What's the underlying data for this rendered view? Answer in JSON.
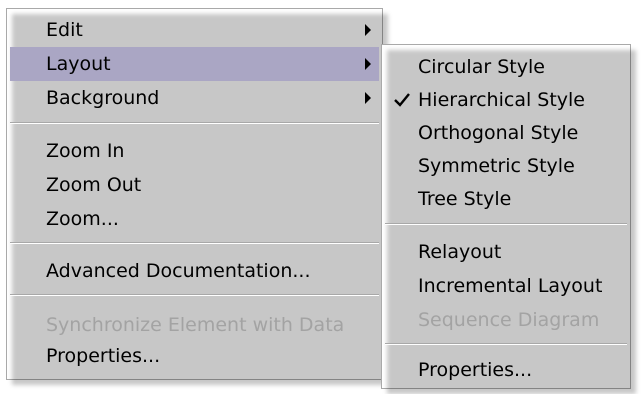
{
  "main_menu": {
    "items": [
      {
        "label": "Edit",
        "has_submenu": true,
        "state": "normal"
      },
      {
        "label": "Layout",
        "has_submenu": true,
        "state": "highlighted"
      },
      {
        "label": "Background",
        "has_submenu": true,
        "state": "normal"
      },
      {
        "label": "Zoom In",
        "state": "normal"
      },
      {
        "label": "Zoom Out",
        "state": "normal"
      },
      {
        "label": "Zoom...",
        "state": "normal"
      },
      {
        "label": "Advanced Documentation...",
        "state": "normal"
      },
      {
        "label": "Synchronize Element with Data",
        "state": "disabled"
      },
      {
        "label": "Properties...",
        "state": "normal"
      }
    ]
  },
  "layout_submenu": {
    "items": [
      {
        "label": "Circular Style",
        "checked": false,
        "state": "normal"
      },
      {
        "label": "Hierarchical Style",
        "checked": true,
        "state": "normal"
      },
      {
        "label": "Orthogonal Style",
        "checked": false,
        "state": "normal"
      },
      {
        "label": "Symmetric Style",
        "checked": false,
        "state": "normal"
      },
      {
        "label": "Tree Style",
        "checked": false,
        "state": "normal"
      },
      {
        "label": "Relayout",
        "checked": false,
        "state": "normal"
      },
      {
        "label": "Incremental Layout",
        "checked": false,
        "state": "normal"
      },
      {
        "label": "Sequence Diagram",
        "checked": false,
        "state": "disabled"
      },
      {
        "label": "Properties...",
        "checked": false,
        "state": "normal"
      }
    ]
  },
  "colors": {
    "highlight": "#aaa6c4",
    "disabled_text": "#a3a3a3",
    "separator": "#a8a8a8"
  },
  "icons": {
    "submenu_arrow": "triangle-right",
    "checked_item": "checkmark"
  }
}
